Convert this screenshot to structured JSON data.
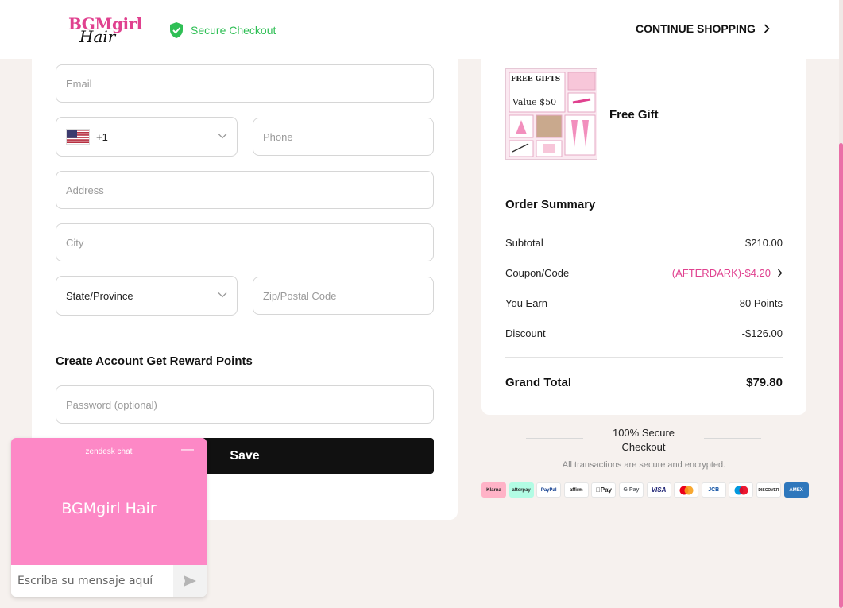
{
  "header": {
    "logo_top": "BGMgirl",
    "logo_bottom": "Hair",
    "secure_checkout": "Secure Checkout",
    "continue_shopping": "CONTINUE SHOPPING"
  },
  "form": {
    "email_placeholder": "Email",
    "country_code": "+1",
    "phone_placeholder": "Phone",
    "address_placeholder": "Address",
    "city_placeholder": "City",
    "state_value": "State/Province",
    "zip_placeholder": "Zip/Postal Code",
    "account_title": "Create Account Get Reward Points",
    "password_placeholder": "Password (optional)",
    "save_label": "Save"
  },
  "gift": {
    "img_title": "FREE GIFTS",
    "img_value": "Value $50",
    "label": "Free Gift"
  },
  "summary": {
    "title": "Order Summary",
    "subtotal_label": "Subtotal",
    "subtotal_value": "$210.00",
    "coupon_label": "Coupon/Code",
    "coupon_value": "(AFTERDARK)-$4.20",
    "earn_label": "You Earn",
    "earn_value": "80 Points",
    "discount_label": "Discount",
    "discount_value": "-$126.00",
    "grand_label": "Grand Total",
    "grand_value": "$79.80"
  },
  "secure_footer": {
    "head": "100% Secure Checkout",
    "sub": "All transactions are secure and encrypted."
  },
  "payments": [
    "Klarna",
    "afterpay",
    "PayPal",
    "affirm",
    "Pay",
    "G Pay",
    "VISA",
    "mastercard",
    "JCB",
    "maestro",
    "DISCOVER",
    "AMEX"
  ],
  "chat": {
    "brand": "zendesk chat",
    "name": "BGMgirl Hair",
    "input_placeholder": "Escriba su mensaje aquí"
  },
  "colors": {
    "accent": "#e0418f",
    "secure_green": "#2fbf55",
    "chat_pink": "#fd88c6",
    "page_bg": "#f6f1ee"
  }
}
